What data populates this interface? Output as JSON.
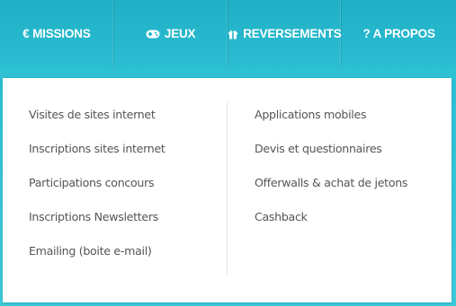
{
  "nav": {
    "items": [
      {
        "icon": "euro-icon",
        "label": "€ MISSIONS"
      },
      {
        "icon": "gamepad-icon",
        "label": "JEUX"
      },
      {
        "icon": "gift-icon",
        "label": "REVERSEMENTS"
      },
      {
        "icon": "question-icon",
        "label": "? A PROPOS"
      }
    ]
  },
  "dropdown": {
    "left_items": [
      "Visites de sites internet",
      "Inscriptions sites internet",
      "Participations concours",
      "Inscriptions Newsletters",
      "Emailing (boite e-mail)"
    ],
    "right_items": [
      "Applications mobiles",
      "Devis et questionnaires",
      "Offerwalls & achat de jetons",
      "Cashback"
    ]
  },
  "colors": {
    "nav_background": "#22b8cd",
    "nav_text": "#ffffff",
    "menu_text": "#555555",
    "panel_background": "#ffffff"
  }
}
